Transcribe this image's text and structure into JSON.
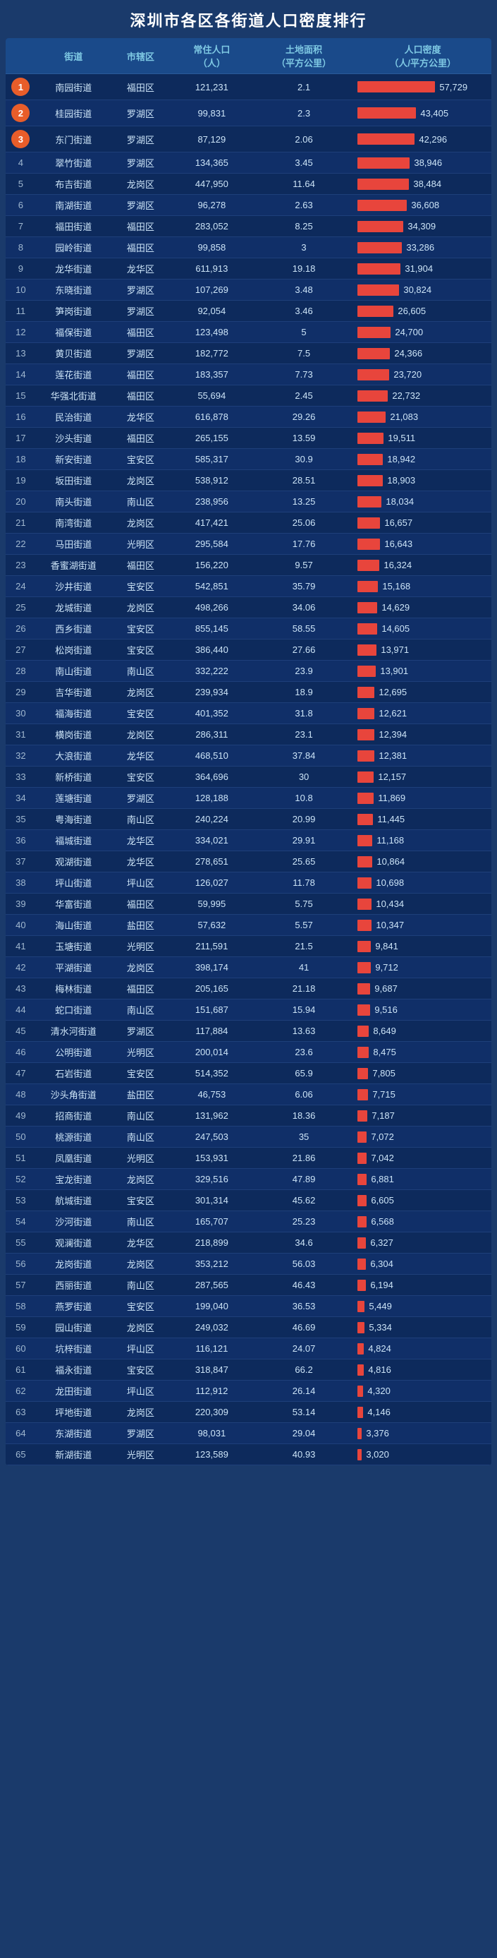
{
  "title": "深圳市各区各街道人口密度排行",
  "headers": {
    "rank": "",
    "street": "街道",
    "district": "市辖区",
    "population": "常住人口（人）",
    "area": "土地面积（平方公里）",
    "density": "人口密度（人/平方公里）"
  },
  "maxDensity": 57729,
  "rows": [
    {
      "rank": 1,
      "street": "南园街道",
      "district": "福田区",
      "population": 121231,
      "area": 2.1,
      "density": 57729
    },
    {
      "rank": 2,
      "street": "桂园街道",
      "district": "罗湖区",
      "population": 99831,
      "area": 2.3,
      "density": 43405
    },
    {
      "rank": 3,
      "street": "东门街道",
      "district": "罗湖区",
      "population": 87129,
      "area": 2.06,
      "density": 42296
    },
    {
      "rank": 4,
      "street": "翠竹街道",
      "district": "罗湖区",
      "population": 134365,
      "area": 3.45,
      "density": 38946
    },
    {
      "rank": 5,
      "street": "布吉街道",
      "district": "龙岗区",
      "population": 447950,
      "area": 11.64,
      "density": 38484
    },
    {
      "rank": 6,
      "street": "南湖街道",
      "district": "罗湖区",
      "population": 96278,
      "area": 2.63,
      "density": 36608
    },
    {
      "rank": 7,
      "street": "福田街道",
      "district": "福田区",
      "population": 283052,
      "area": 8.25,
      "density": 34309
    },
    {
      "rank": 8,
      "street": "园岭街道",
      "district": "福田区",
      "population": 99858,
      "area": 3,
      "density": 33286
    },
    {
      "rank": 9,
      "street": "龙华街道",
      "district": "龙华区",
      "population": 611913,
      "area": 19.18,
      "density": 31904
    },
    {
      "rank": 10,
      "street": "东晓街道",
      "district": "罗湖区",
      "population": 107269,
      "area": 3.48,
      "density": 30824
    },
    {
      "rank": 11,
      "street": "笋岗街道",
      "district": "罗湖区",
      "population": 92054,
      "area": 3.46,
      "density": 26605
    },
    {
      "rank": 12,
      "street": "福保街道",
      "district": "福田区",
      "population": 123498,
      "area": 5,
      "density": 24700
    },
    {
      "rank": 13,
      "street": "黄贝街道",
      "district": "罗湖区",
      "population": 182772,
      "area": 7.5,
      "density": 24366
    },
    {
      "rank": 14,
      "street": "莲花街道",
      "district": "福田区",
      "population": 183357,
      "area": 7.73,
      "density": 23720
    },
    {
      "rank": 15,
      "street": "华强北街道",
      "district": "福田区",
      "population": 55694,
      "area": 2.45,
      "density": 22732
    },
    {
      "rank": 16,
      "street": "民治街道",
      "district": "龙华区",
      "population": 616878,
      "area": 29.26,
      "density": 21083
    },
    {
      "rank": 17,
      "street": "沙头街道",
      "district": "福田区",
      "population": 265155,
      "area": 13.59,
      "density": 19511
    },
    {
      "rank": 18,
      "street": "新安街道",
      "district": "宝安区",
      "population": 585317,
      "area": 30.9,
      "density": 18942
    },
    {
      "rank": 19,
      "street": "坂田街道",
      "district": "龙岗区",
      "population": 538912,
      "area": 28.51,
      "density": 18903
    },
    {
      "rank": 20,
      "street": "南头街道",
      "district": "南山区",
      "population": 238956,
      "area": 13.25,
      "density": 18034
    },
    {
      "rank": 21,
      "street": "南湾街道",
      "district": "龙岗区",
      "population": 417421,
      "area": 25.06,
      "density": 16657
    },
    {
      "rank": 22,
      "street": "马田街道",
      "district": "光明区",
      "population": 295584,
      "area": 17.76,
      "density": 16643
    },
    {
      "rank": 23,
      "street": "香蜜湖街道",
      "district": "福田区",
      "population": 156220,
      "area": 9.57,
      "density": 16324
    },
    {
      "rank": 24,
      "street": "沙井街道",
      "district": "宝安区",
      "population": 542851,
      "area": 35.79,
      "density": 15168
    },
    {
      "rank": 25,
      "street": "龙城街道",
      "district": "龙岗区",
      "population": 498266,
      "area": 34.06,
      "density": 14629
    },
    {
      "rank": 26,
      "street": "西乡街道",
      "district": "宝安区",
      "population": 855145,
      "area": 58.55,
      "density": 14605
    },
    {
      "rank": 27,
      "street": "松岗街道",
      "district": "宝安区",
      "population": 386440,
      "area": 27.66,
      "density": 13971
    },
    {
      "rank": 28,
      "street": "南山街道",
      "district": "南山区",
      "population": 332222,
      "area": 23.9,
      "density": 13901
    },
    {
      "rank": 29,
      "street": "吉华街道",
      "district": "龙岗区",
      "population": 239934,
      "area": 18.9,
      "density": 12695
    },
    {
      "rank": 30,
      "street": "福海街道",
      "district": "宝安区",
      "population": 401352,
      "area": 31.8,
      "density": 12621
    },
    {
      "rank": 31,
      "street": "横岗街道",
      "district": "龙岗区",
      "population": 286311,
      "area": 23.1,
      "density": 12394
    },
    {
      "rank": 32,
      "street": "大浪街道",
      "district": "龙华区",
      "population": 468510,
      "area": 37.84,
      "density": 12381
    },
    {
      "rank": 33,
      "street": "新桥街道",
      "district": "宝安区",
      "population": 364696,
      "area": 30,
      "density": 12157
    },
    {
      "rank": 34,
      "street": "莲塘街道",
      "district": "罗湖区",
      "population": 128188,
      "area": 10.8,
      "density": 11869
    },
    {
      "rank": 35,
      "street": "粤海街道",
      "district": "南山区",
      "population": 240224,
      "area": 20.99,
      "density": 11445
    },
    {
      "rank": 36,
      "street": "福城街道",
      "district": "龙华区",
      "population": 334021,
      "area": 29.91,
      "density": 11168
    },
    {
      "rank": 37,
      "street": "观湖街道",
      "district": "龙华区",
      "population": 278651,
      "area": 25.65,
      "density": 10864
    },
    {
      "rank": 38,
      "street": "坪山街道",
      "district": "坪山区",
      "population": 126027,
      "area": 11.78,
      "density": 10698
    },
    {
      "rank": 39,
      "street": "华富街道",
      "district": "福田区",
      "population": 59995,
      "area": 5.75,
      "density": 10434
    },
    {
      "rank": 40,
      "street": "海山街道",
      "district": "盐田区",
      "population": 57632,
      "area": 5.57,
      "density": 10347
    },
    {
      "rank": 41,
      "street": "玉塘街道",
      "district": "光明区",
      "population": 211591,
      "area": 21.5,
      "density": 9841
    },
    {
      "rank": 42,
      "street": "平湖街道",
      "district": "龙岗区",
      "population": 398174,
      "area": 41,
      "density": 9712
    },
    {
      "rank": 43,
      "street": "梅林街道",
      "district": "福田区",
      "population": 205165,
      "area": 21.18,
      "density": 9687
    },
    {
      "rank": 44,
      "street": "蛇口街道",
      "district": "南山区",
      "population": 151687,
      "area": 15.94,
      "density": 9516
    },
    {
      "rank": 45,
      "street": "清水河街道",
      "district": "罗湖区",
      "population": 117884,
      "area": 13.63,
      "density": 8649
    },
    {
      "rank": 46,
      "street": "公明街道",
      "district": "光明区",
      "population": 200014,
      "area": 23.6,
      "density": 8475
    },
    {
      "rank": 47,
      "street": "石岩街道",
      "district": "宝安区",
      "population": 514352,
      "area": 65.9,
      "density": 7805
    },
    {
      "rank": 48,
      "street": "沙头角街道",
      "district": "盐田区",
      "population": 46753,
      "area": 6.06,
      "density": 7715
    },
    {
      "rank": 49,
      "street": "招商街道",
      "district": "南山区",
      "population": 131962,
      "area": 18.36,
      "density": 7187
    },
    {
      "rank": 50,
      "street": "桃源街道",
      "district": "南山区",
      "population": 247503,
      "area": 35,
      "density": 7072
    },
    {
      "rank": 51,
      "street": "凤凰街道",
      "district": "光明区",
      "population": 153931,
      "area": 21.86,
      "density": 7042
    },
    {
      "rank": 52,
      "street": "宝龙街道",
      "district": "龙岗区",
      "population": 329516,
      "area": 47.89,
      "density": 6881
    },
    {
      "rank": 53,
      "street": "航城街道",
      "district": "宝安区",
      "population": 301314,
      "area": 45.62,
      "density": 6605
    },
    {
      "rank": 54,
      "street": "沙河街道",
      "district": "南山区",
      "population": 165707,
      "area": 25.23,
      "density": 6568
    },
    {
      "rank": 55,
      "street": "观澜街道",
      "district": "龙华区",
      "population": 218899,
      "area": 34.6,
      "density": 6327
    },
    {
      "rank": 56,
      "street": "龙岗街道",
      "district": "龙岗区",
      "population": 353212,
      "area": 56.03,
      "density": 6304
    },
    {
      "rank": 57,
      "street": "西丽街道",
      "district": "南山区",
      "population": 287565,
      "area": 46.43,
      "density": 6194
    },
    {
      "rank": 58,
      "street": "燕罗街道",
      "district": "宝安区",
      "population": 199040,
      "area": 36.53,
      "density": 5449
    },
    {
      "rank": 59,
      "street": "园山街道",
      "district": "龙岗区",
      "population": 249032,
      "area": 46.69,
      "density": 5334
    },
    {
      "rank": 60,
      "street": "坑梓街道",
      "district": "坪山区",
      "population": 116121,
      "area": 24.07,
      "density": 4824
    },
    {
      "rank": 61,
      "street": "福永街道",
      "district": "宝安区",
      "population": 318847,
      "area": 66.2,
      "density": 4816
    },
    {
      "rank": 62,
      "street": "龙田街道",
      "district": "坪山区",
      "population": 112912,
      "area": 26.14,
      "density": 4320
    },
    {
      "rank": 63,
      "street": "坪地街道",
      "district": "龙岗区",
      "population": 220309,
      "area": 53.14,
      "density": 4146
    },
    {
      "rank": 64,
      "street": "东湖街道",
      "district": "罗湖区",
      "population": 98031,
      "area": 29.04,
      "density": 3376
    },
    {
      "rank": 65,
      "street": "新湖街道",
      "district": "光明区",
      "population": 123589,
      "area": 40.93,
      "density": 3020
    }
  ]
}
